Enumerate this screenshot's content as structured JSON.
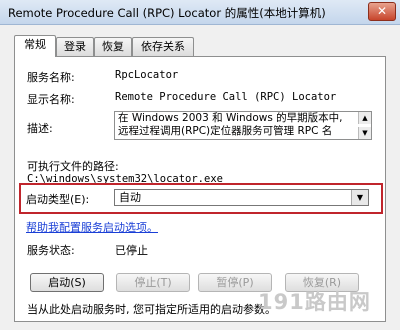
{
  "window": {
    "title": "Remote Procedure Call (RPC) Locator 的属性(本地计算机)",
    "close_glyph": "✕"
  },
  "tabs": [
    {
      "label": "常规",
      "active": true
    },
    {
      "label": "登录",
      "active": false
    },
    {
      "label": "恢复",
      "active": false
    },
    {
      "label": "依存关系",
      "active": false
    }
  ],
  "general": {
    "service_name_label": "服务名称:",
    "service_name_value": "RpcLocator",
    "display_name_label": "显示名称:",
    "display_name_value": "Remote Procedure Call (RPC) Locator",
    "description_label": "描述:",
    "description_line1": "在 Windows 2003 和 Windows 的早期版本中,",
    "description_line2": "远程过程调用(RPC)定位器服务可管理 RPC 名",
    "exe_path_label": "可执行文件的路径:",
    "exe_path_value": "C:\\windows\\system32\\locator.exe",
    "startup_type_label": "启动类型(E):",
    "startup_type_value": "自动",
    "help_link": "帮助我配置服务启动选项。",
    "service_status_label": "服务状态:",
    "service_status_value": "已停止",
    "footer_hint": "当从此处启动服务时, 您可指定所适用的启动参数。"
  },
  "buttons": {
    "start": "启动(S)",
    "stop": "停止(T)",
    "pause": "暂停(P)",
    "resume": "恢复(R)"
  },
  "watermark": "191路由网",
  "colors": {
    "highlight_border": "#c0252c",
    "link": "#1a3fd6"
  }
}
